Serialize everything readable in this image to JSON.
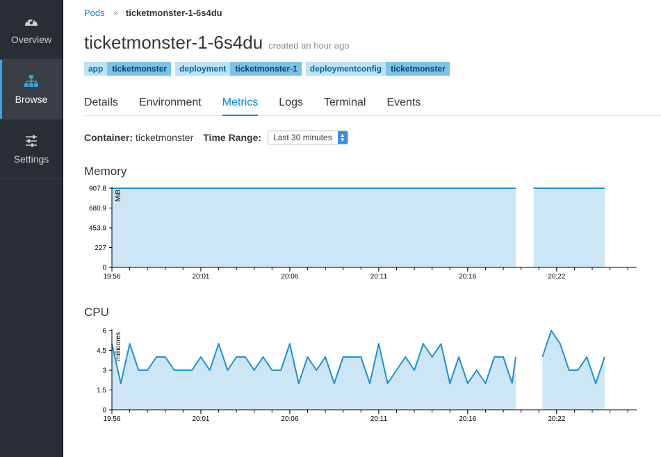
{
  "nav": {
    "items": [
      {
        "label": "Overview",
        "icon": "dashboard-icon",
        "active": false
      },
      {
        "label": "Browse",
        "icon": "sitemap-icon",
        "active": true
      },
      {
        "label": "Settings",
        "icon": "sliders-icon",
        "active": false
      }
    ]
  },
  "breadcrumb": {
    "parent": "Pods",
    "current": "ticketmonster-1-6s4du"
  },
  "page": {
    "title": "ticketmonster-1-6s4du",
    "subtitle": "created an hour ago"
  },
  "labels": [
    {
      "key": "app",
      "value": "ticketmonster"
    },
    {
      "key": "deployment",
      "value": "ticketmonster-1"
    },
    {
      "key": "deploymentconfig",
      "value": "ticketmonster"
    }
  ],
  "tabs": [
    "Details",
    "Environment",
    "Metrics",
    "Logs",
    "Terminal",
    "Events"
  ],
  "active_tab": "Metrics",
  "filters": {
    "container_label": "Container:",
    "container_value": "ticketmonster",
    "time_range_label": "Time Range:",
    "time_range_value": "Last 30 minutes"
  },
  "colors": {
    "accent": "#0088ce",
    "series_line": "#1f8fd0",
    "series_fill": "#cde6f6",
    "nav_bg": "#292e34"
  },
  "chart_data": [
    {
      "type": "area",
      "title": "Memory",
      "ylabel": "MiB",
      "ylim": [
        0,
        907.8
      ],
      "yticks": [
        0,
        227,
        453.9,
        680.9,
        907.8
      ],
      "xlim": [
        0,
        29.5
      ],
      "xtick_labels": [
        {
          "x": 0,
          "label": "19:56"
        },
        {
          "x": 5,
          "label": "20:01"
        },
        {
          "x": 10,
          "label": "20:06"
        },
        {
          "x": 15,
          "label": "20:11"
        },
        {
          "x": 20,
          "label": "20:16"
        },
        {
          "x": 25,
          "label": "20:22"
        }
      ],
      "segments": [
        {
          "x": [
            0,
            22.7
          ],
          "y": [
            907.8,
            907.8
          ]
        },
        {
          "x": [
            23.7,
            27.7
          ],
          "y": [
            907.8,
            907.8
          ]
        }
      ]
    },
    {
      "type": "area",
      "title": "CPU",
      "ylabel": "millicores",
      "ylim": [
        0,
        6
      ],
      "yticks": [
        0,
        1.5,
        3,
        4.5,
        6
      ],
      "xlim": [
        0,
        29.5
      ],
      "xtick_labels": [
        {
          "x": 0,
          "label": "19:56"
        },
        {
          "x": 5,
          "label": "20:01"
        },
        {
          "x": 10,
          "label": "20:06"
        },
        {
          "x": 15,
          "label": "20:11"
        },
        {
          "x": 20,
          "label": "20:16"
        },
        {
          "x": 25,
          "label": "20:22"
        }
      ],
      "segments": [
        {
          "x": [
            0,
            0.5,
            1,
            1.5,
            2,
            2.5,
            3,
            3.5,
            4,
            4.5,
            5,
            5.5,
            6,
            6.5,
            7,
            7.5,
            8,
            8.5,
            9,
            9.5,
            10,
            10.5,
            11,
            11.5,
            12,
            12.5,
            13,
            13.5,
            14,
            14.5,
            15,
            15.5,
            16,
            16.5,
            17,
            17.5,
            18,
            18.5,
            19,
            19.5,
            20,
            20.5,
            21,
            21.5,
            22,
            22.5
          ],
          "y": [
            5,
            2,
            5,
            3,
            3,
            4,
            4,
            3,
            3,
            3,
            4,
            3,
            5,
            3,
            4,
            4,
            3,
            4,
            3,
            3,
            5,
            2,
            4,
            3,
            4,
            2,
            4,
            4,
            4,
            2,
            5,
            2,
            3,
            4,
            3,
            5,
            4,
            5,
            2,
            4,
            2,
            3,
            2,
            4,
            4,
            2
          ]
        },
        {
          "x": [
            22.5,
            22.7
          ],
          "y": [
            2,
            4
          ]
        },
        {
          "x": [
            24.2,
            24.7,
            25.2,
            25.7,
            26.2,
            26.7,
            27.2,
            27.7
          ],
          "y": [
            4,
            6,
            5,
            3,
            3,
            4,
            2,
            4
          ]
        }
      ]
    }
  ]
}
